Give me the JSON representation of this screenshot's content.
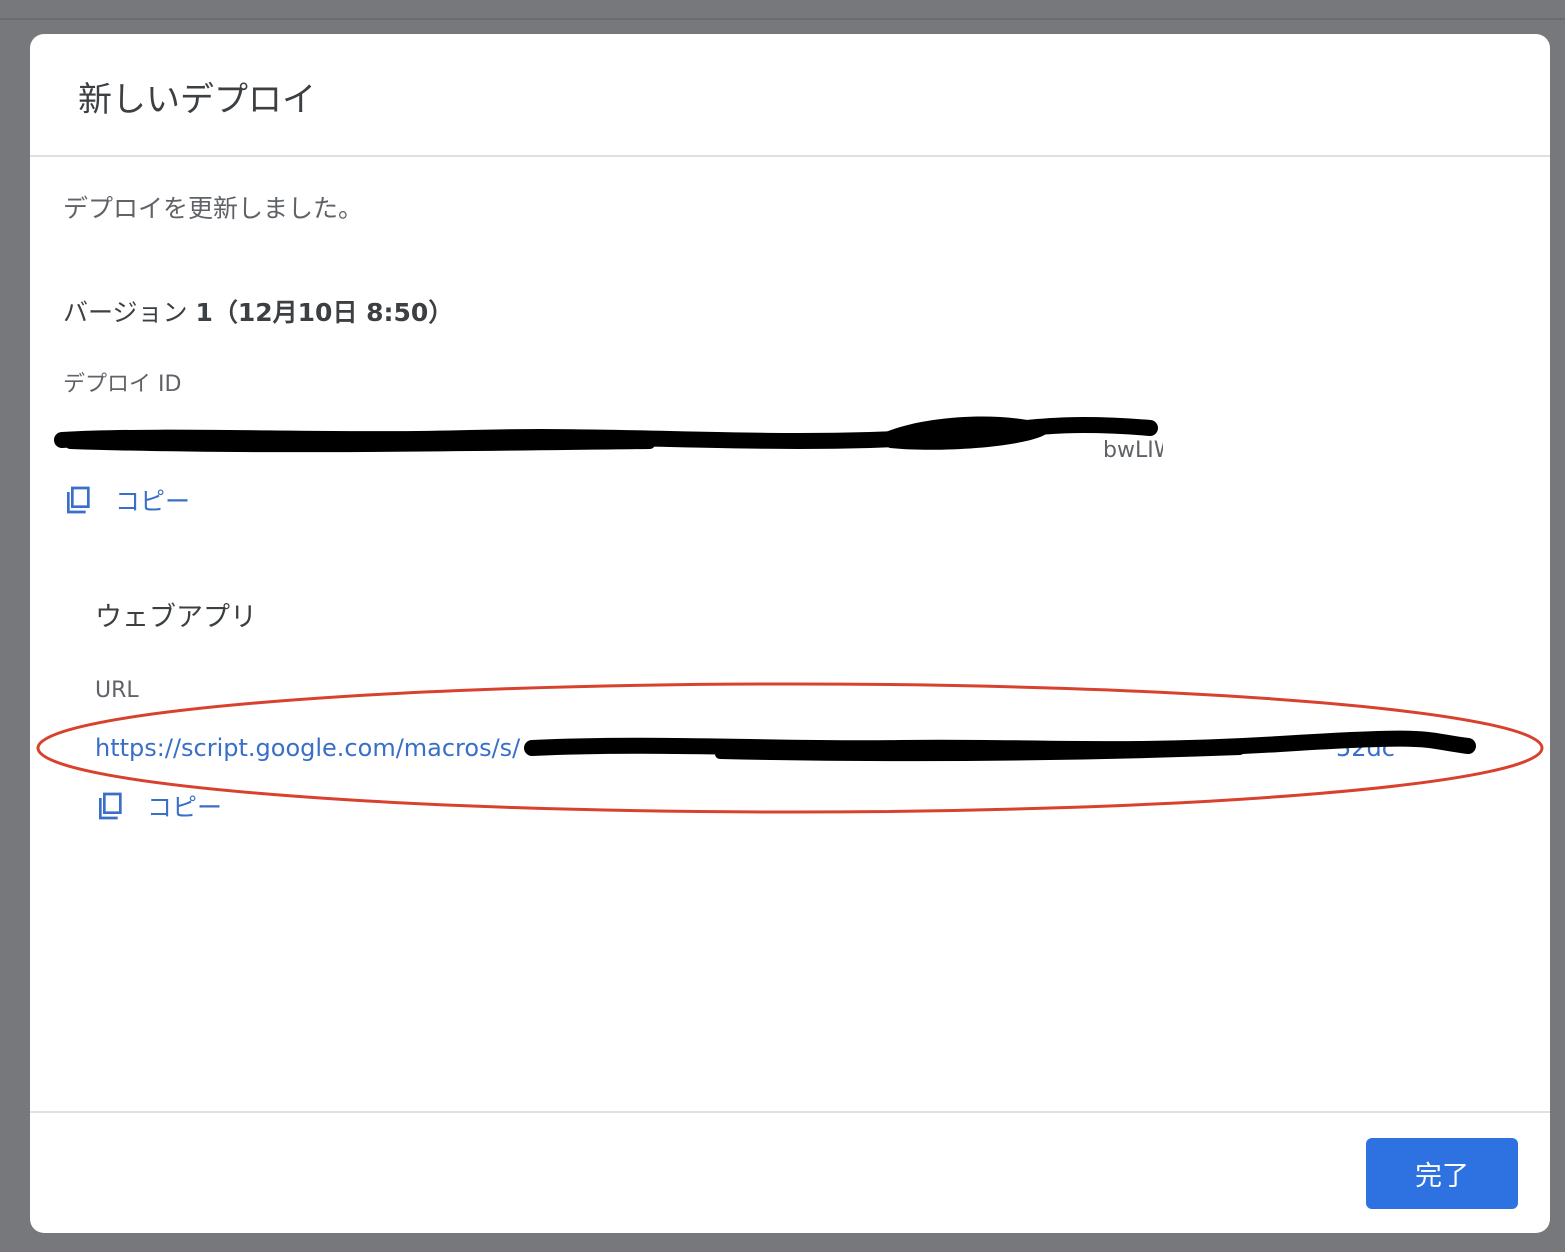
{
  "dialog": {
    "title": "新しいデプロイ",
    "message": "デプロイを更新しました。",
    "version_prefix": "バージョン ",
    "version_number": "1",
    "version_detail": "（12月10日 8:50）",
    "deploy_id_label": "デプロイ ID",
    "deploy_id_visible_tail": "bwLIWI",
    "copy_label": "コピー",
    "webapp_section": "ウェブアプリ",
    "url_label": "URL",
    "url_visible": "https://script.google.com/macros/s/",
    "url_visible_tail": "52dc",
    "done_button": "完了"
  },
  "icons": {
    "copy": "content-copy-icon"
  },
  "colors": {
    "backdrop": "#77787b",
    "link": "#3a6fc8",
    "primary_button": "#2d72e0",
    "annotation": "#d9412f",
    "redaction": "#000000"
  }
}
